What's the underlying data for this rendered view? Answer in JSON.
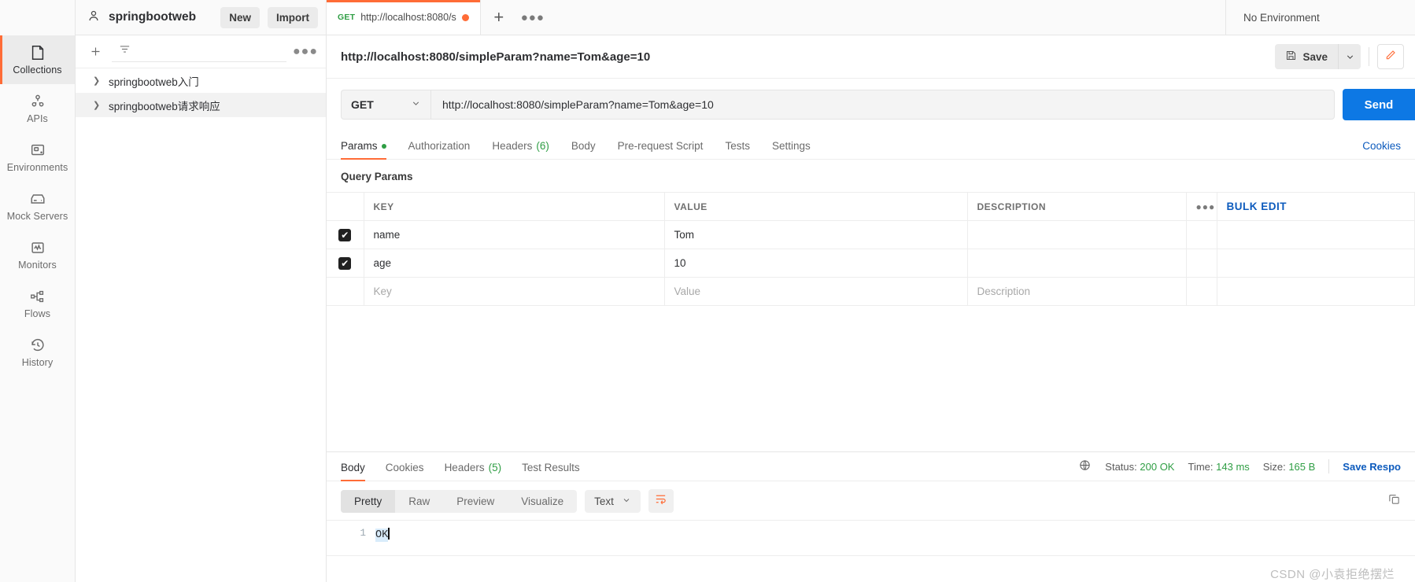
{
  "sidebar": {
    "workspace_name": "springbootweb",
    "new_label": "New",
    "import_label": "Import",
    "filter_placeholder": "",
    "more_glyph": "●●●",
    "collections": [
      {
        "label": "springbootweb入门",
        "selected": false
      },
      {
        "label": "springbootweb请求响应",
        "selected": true
      }
    ]
  },
  "rail": {
    "items": [
      {
        "label": "Collections",
        "icon": "collections-icon",
        "active": true
      },
      {
        "label": "APIs",
        "icon": "apis-icon",
        "active": false
      },
      {
        "label": "Environments",
        "icon": "environments-icon",
        "active": false
      },
      {
        "label": "Mock Servers",
        "icon": "mock-servers-icon",
        "active": false
      },
      {
        "label": "Monitors",
        "icon": "monitors-icon",
        "active": false
      },
      {
        "label": "Flows",
        "icon": "flows-icon",
        "active": false
      },
      {
        "label": "History",
        "icon": "history-icon",
        "active": false
      }
    ]
  },
  "tabstrip": {
    "tab_method": "GET",
    "tab_title": "http://localhost:8080/s",
    "plus_glyph": "+",
    "ellipsis_glyph": "●●●",
    "environment": "No Environment"
  },
  "request_header": {
    "name": "http://localhost:8080/simpleParam?name=Tom&age=10",
    "save_label": "Save",
    "caret_glyph": "⌄",
    "edit_icon": "pencil-icon"
  },
  "url_bar": {
    "method": "GET",
    "url": "http://localhost:8080/simpleParam?name=Tom&age=10",
    "send_label": "Send"
  },
  "request_tabs": {
    "items": [
      {
        "label": "Params",
        "dot": true,
        "count": "",
        "active": true
      },
      {
        "label": "Authorization",
        "dot": false,
        "count": "",
        "active": false
      },
      {
        "label": "Headers",
        "dot": false,
        "count": "(6)",
        "active": false
      },
      {
        "label": "Body",
        "dot": false,
        "count": "",
        "active": false
      },
      {
        "label": "Pre-request Script",
        "dot": false,
        "count": "",
        "active": false
      },
      {
        "label": "Tests",
        "dot": false,
        "count": "",
        "active": false
      },
      {
        "label": "Settings",
        "dot": false,
        "count": "",
        "active": false
      }
    ],
    "cookies_link": "Cookies"
  },
  "query_params": {
    "section_title": "Query Params",
    "columns": [
      "KEY",
      "VALUE",
      "DESCRIPTION"
    ],
    "dots_glyph": "●●●",
    "bulk_edit_label": "Bulk Edit",
    "rows": [
      {
        "checked": true,
        "key": "name",
        "value": "Tom",
        "description": ""
      },
      {
        "checked": true,
        "key": "age",
        "value": "10",
        "description": ""
      }
    ],
    "new_row": {
      "key_placeholder": "Key",
      "value_placeholder": "Value",
      "description_placeholder": "Description"
    },
    "checkmark": "✔"
  },
  "response": {
    "tabs": [
      {
        "label": "Body",
        "count": "",
        "active": true
      },
      {
        "label": "Cookies",
        "count": "",
        "active": false
      },
      {
        "label": "Headers",
        "count": "(5)",
        "active": false
      },
      {
        "label": "Test Results",
        "count": "",
        "active": false
      }
    ],
    "globe_icon": "globe-icon",
    "status_label": "Status:",
    "status_value": "200 OK",
    "time_label": "Time:",
    "time_value": "143 ms",
    "size_label": "Size:",
    "size_value": "165 B",
    "save_response_label": "Save Respo",
    "view_modes": [
      "Pretty",
      "Raw",
      "Preview",
      "Visualize"
    ],
    "active_view": "Pretty",
    "format_label": "Text",
    "format_caret": "⌄",
    "wrap_icon": "wrap-lines-icon",
    "copy_icon": "copy-icon",
    "line_number": "1",
    "body_text": "OK"
  },
  "watermark": "CSDN @小袁拒绝摆烂",
  "colors": {
    "accent": "#ff6c37",
    "send_blue": "#0d78e4",
    "link_blue": "#0d5bbd",
    "green": "#2f9e44"
  }
}
